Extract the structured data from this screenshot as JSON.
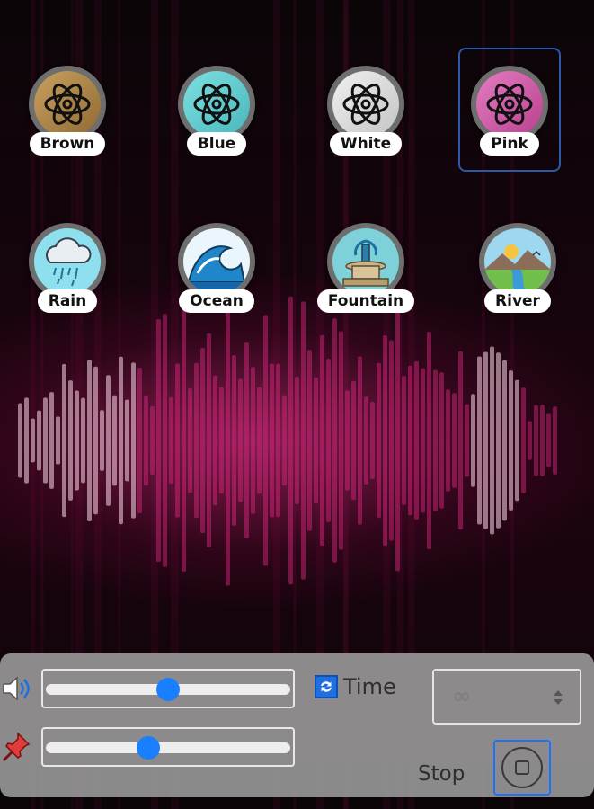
{
  "sounds": [
    {
      "id": "brown",
      "label": "Brown",
      "selected": false,
      "icon": "atom-icon",
      "color": "#b38a4a"
    },
    {
      "id": "blue",
      "label": "Blue",
      "selected": false,
      "icon": "atom-icon",
      "color": "#66cdd0"
    },
    {
      "id": "white",
      "label": "White",
      "selected": false,
      "icon": "atom-icon",
      "color": "#dcdcdc"
    },
    {
      "id": "pink",
      "label": "Pink",
      "selected": true,
      "icon": "atom-icon",
      "color": "#d65cae"
    },
    {
      "id": "rain",
      "label": "Rain",
      "selected": false,
      "icon": "rain-cloud-icon",
      "color": "#8fe0ee"
    },
    {
      "id": "ocean",
      "label": "Ocean",
      "selected": false,
      "icon": "ocean-wave-icon",
      "color": "#eaf6fb"
    },
    {
      "id": "fountain",
      "label": "Fountain",
      "selected": false,
      "icon": "fountain-icon",
      "color": "#7ed1d8"
    },
    {
      "id": "river",
      "label": "River",
      "selected": false,
      "icon": "river-landscape-icon",
      "color": "#9ed8f0"
    }
  ],
  "controls": {
    "volume": {
      "icon": "speaker-icon",
      "value": 0.5
    },
    "balance": {
      "icon": "pin-icon",
      "value": 0.41
    },
    "time_toggle": {
      "label": "Time",
      "icon": "refresh-icon",
      "checked": true
    },
    "duration": {
      "value": "∞"
    },
    "stop": {
      "label": "Stop",
      "icon": "stop-icon"
    }
  },
  "colors": {
    "accent": "#1a7fff",
    "selection": "#2a5aa8",
    "panel": "#969496"
  }
}
